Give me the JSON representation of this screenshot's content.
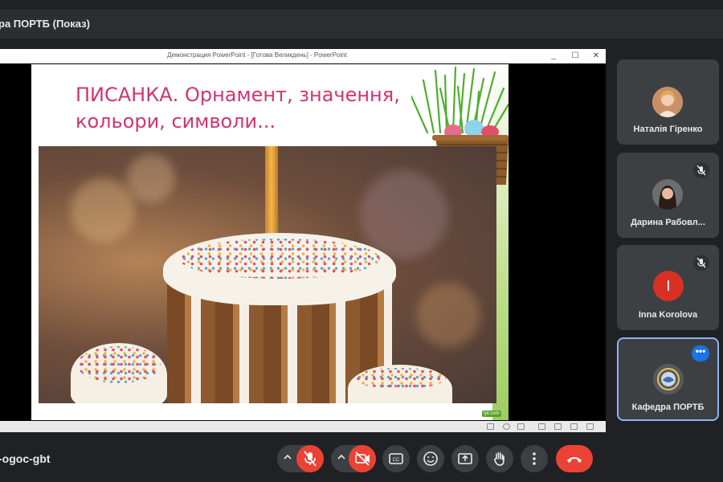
{
  "presentation_header": {
    "title": "ра ПОРТБ (Показ)"
  },
  "ppt_window": {
    "title": "Демонстрация PowerPoint - [Готова Великдень] - PowerPoint",
    "controls": {
      "minimize": "_",
      "restore": "☐",
      "close": "✕"
    }
  },
  "slide": {
    "title_line1": "ПИСАНКА. Орнамент, значення,",
    "title_line2": "кольори, символи...",
    "watermark": "tpt.com"
  },
  "participants": [
    {
      "name": "Наталія Гіренко",
      "muted": false
    },
    {
      "name": "Дарина Рабовл...",
      "muted": true
    },
    {
      "name": "Inna Korolova",
      "muted": true,
      "initial": "I",
      "avatar_color": "#d93025"
    },
    {
      "name": "Кафедра ПОРТБ",
      "active": true,
      "more_label": "•••"
    }
  ],
  "bottom_bar": {
    "meeting_code": "-ogoc-gbt",
    "buttons": [
      "mic-off",
      "camera-off",
      "captions",
      "emoji",
      "present",
      "raise-hand",
      "more-options",
      "end-call"
    ],
    "colors": {
      "danger": "#ea4335",
      "accent": "#1a73e8",
      "button": "#3c4043"
    }
  }
}
